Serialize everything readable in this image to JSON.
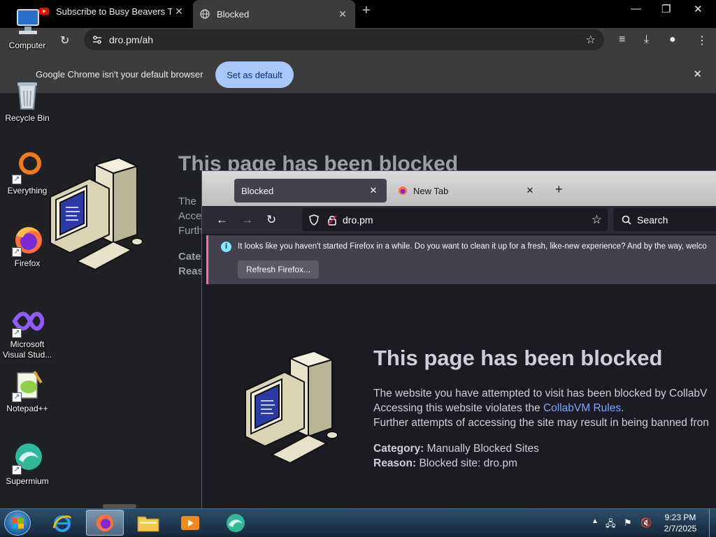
{
  "chrome": {
    "tabs": [
      {
        "label": "Subscribe to Busy Beavers TV for"
      },
      {
        "label": "Blocked"
      }
    ],
    "url": "dro.pm/ah",
    "infobar": {
      "text": "Google Chrome isn't your default browser",
      "button": "Set as default"
    },
    "content": {
      "title": "This page has been blocked",
      "fragments": [
        "The",
        "Acce",
        "Furth",
        "Cate",
        "Reas"
      ]
    }
  },
  "desktop": {
    "icons": [
      {
        "label": "Computer"
      },
      {
        "label": "Recycle Bin"
      },
      {
        "label": "Everything"
      },
      {
        "label": "Firefox"
      },
      {
        "label": "Microsoft Visual Stud..."
      },
      {
        "label": "Notepad++"
      },
      {
        "label": "Supermium"
      }
    ]
  },
  "firefox": {
    "tabs": [
      {
        "label": "Blocked"
      },
      {
        "label": "New Tab"
      }
    ],
    "url": "dro.pm",
    "search_placeholder": "Search",
    "notification": {
      "text": "It looks like you haven't started Firefox in a while. Do you want to clean it up for a fresh, like-new experience? And by the way, welco",
      "button": "Refresh Firefox..."
    },
    "content": {
      "title": "This page has been blocked",
      "line1": "The website you have attempted to visit has been blocked by CollabV",
      "line2_prefix": "Accessing this website violates the ",
      "line2_link": "CollabVM Rules",
      "line2_suffix": ".",
      "line3": "Further attempts of accessing the site may result in being banned fron",
      "category_label": "Category:",
      "category_value": " Manually Blocked Sites",
      "reason_label": "Reason:",
      "reason_value": " Blocked site: dro.pm"
    }
  },
  "taskbar": {
    "clock_time": "9:23 PM",
    "clock_date": "2/7/2025"
  },
  "colors": {
    "chrome_bg": "#202124",
    "set_default_button": "#a8c7fa",
    "firefox_bg": "#1c1b22",
    "firefox_link": "#7aa8ff",
    "notify_accent": "#ff6b9c"
  }
}
